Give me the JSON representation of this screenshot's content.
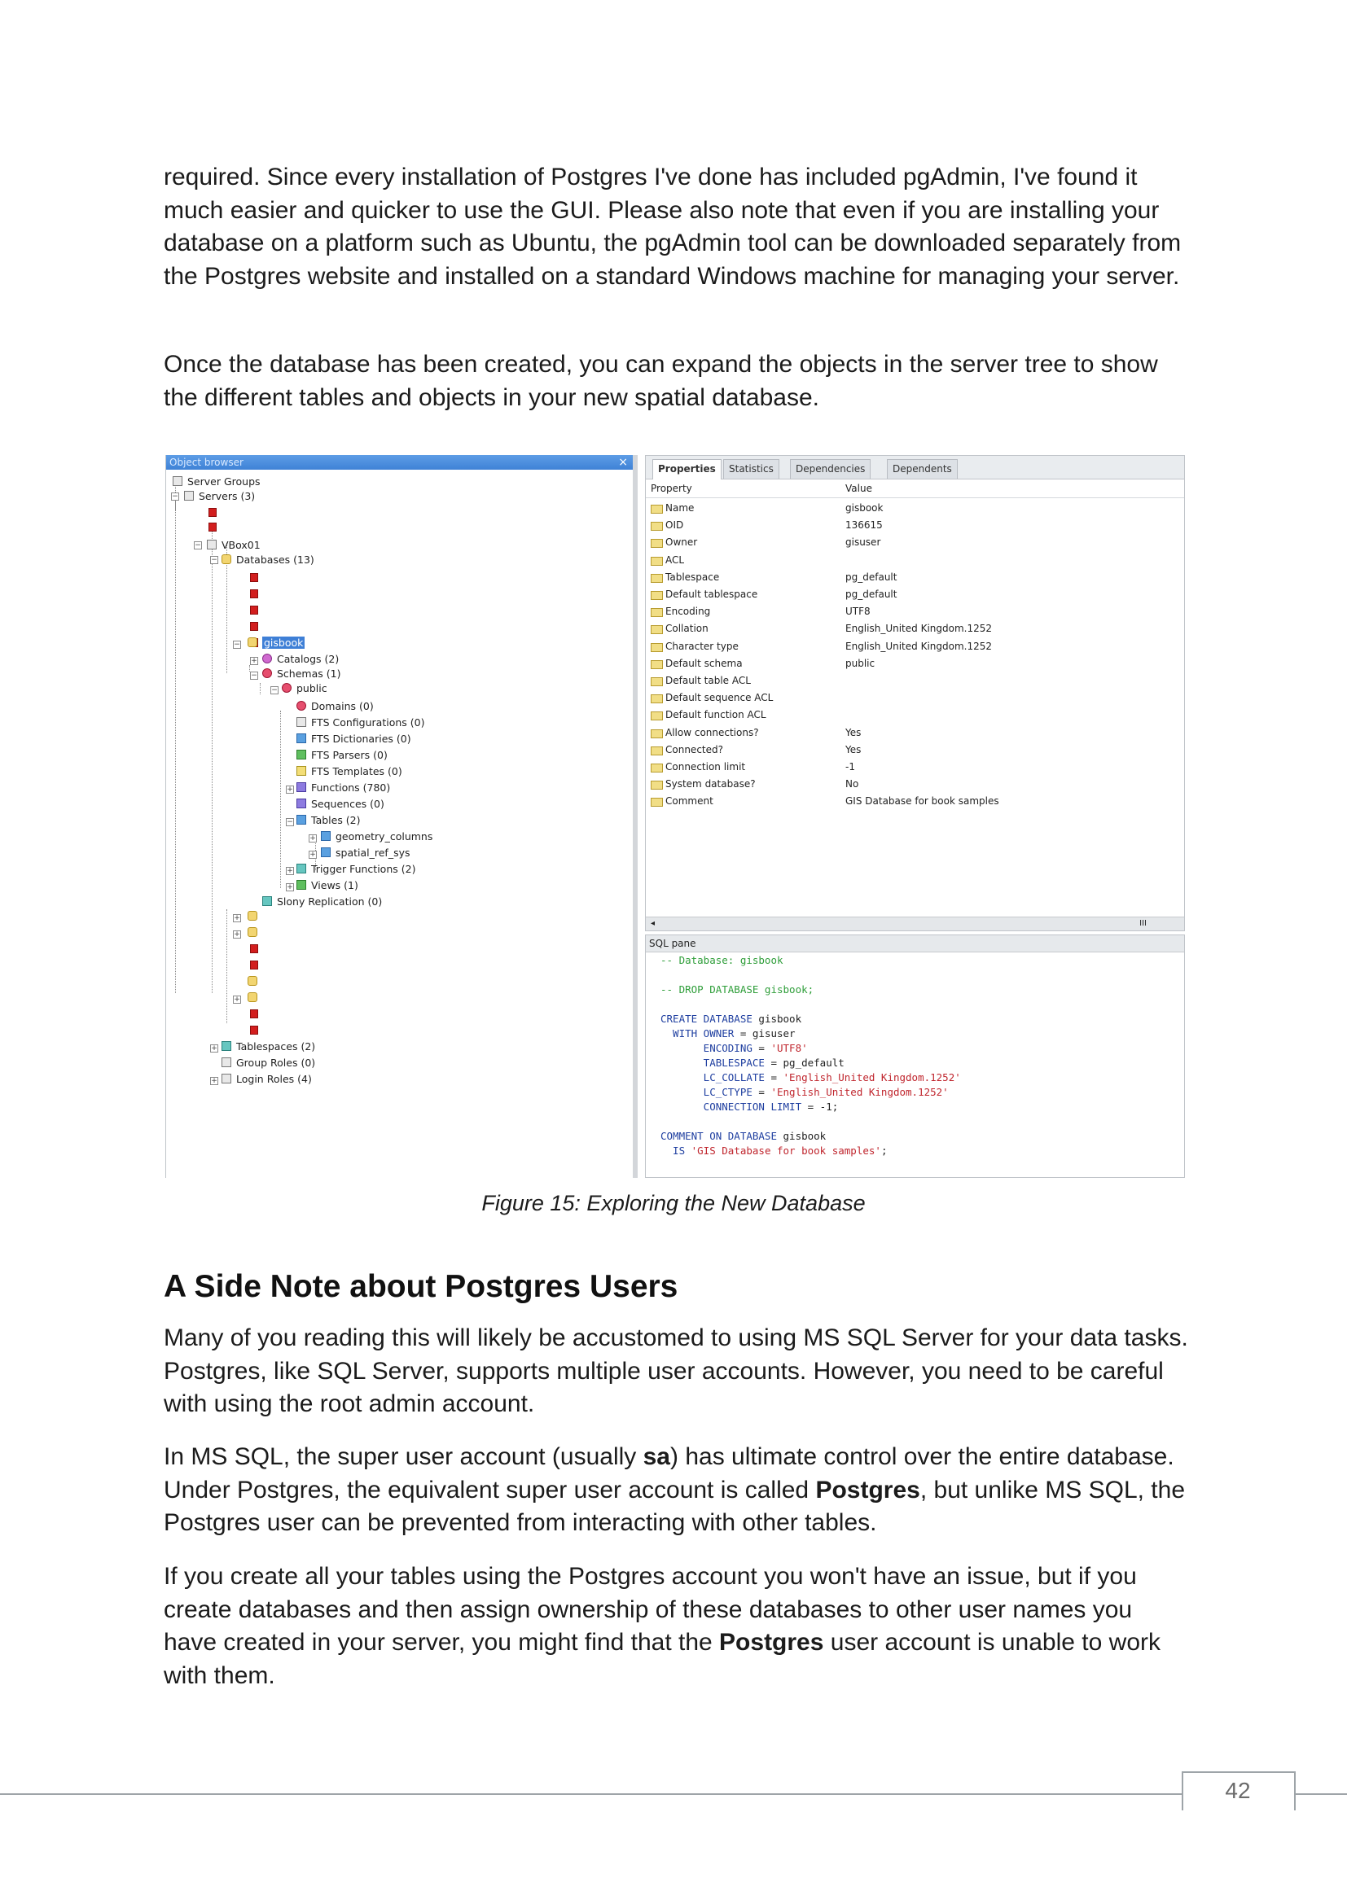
{
  "paragraphs": {
    "p1": "required. Since every installation of Postgres I've done has included pgAdmin, I've found it much easier and quicker to use the GUI. Please also note that even if you are installing your database on a platform such as Ubuntu, the pgAdmin tool can be downloaded separately from the Postgres website and installed on a standard Windows machine for managing your server.",
    "p2": "Once the database has been created, you can expand the objects in the server tree to show the different tables and objects in your new spatial database.",
    "p3": "Many of you reading this will likely be accustomed to using MS SQL Server for your data tasks. Postgres, like SQL Server, supports multiple user accounts. However, you need to be careful with using the root admin account.",
    "p4_a": "In MS SQL, the super user account (usually ",
    "p4_b": "sa",
    "p4_c": ") has ultimate control over the entire database. Under Postgres, the equivalent super user account is called ",
    "p4_d": "Postgres",
    "p4_e": ", but unlike MS SQL, the Postgres user can be prevented from interacting with other tables.",
    "p5_a": "If you create all your tables using the Postgres account you won't have an issue, but if you create databases and then assign ownership of these databases to other user names you have created in your server, you might find that the ",
    "p5_b": "Postgres",
    "p5_c": " user account is unable to work with them."
  },
  "heading": "A Side Note about Postgres Users",
  "caption": "Figure 15: Exploring the New Database",
  "page_number": "42",
  "screenshot": {
    "browser_title": "Object browser",
    "close_glyph": "×",
    "tree": {
      "server_groups": "Server Groups",
      "servers": "Servers (3)",
      "vbox": "VBox01",
      "databases": "Databases (13)",
      "gisbook": "gisbook",
      "catalogs": "Catalogs (2)",
      "schemas": "Schemas (1)",
      "public": "public",
      "domains": "Domains (0)",
      "fts_configurations": "FTS Configurations (0)",
      "fts_dictionaries": "FTS Dictionaries (0)",
      "fts_parsers": "FTS Parsers (0)",
      "fts_templates": "FTS Templates (0)",
      "functions": "Functions (780)",
      "sequences": "Sequences (0)",
      "tables": "Tables (2)",
      "geometry_columns": "geometry_columns",
      "spatial_ref_sys": "spatial_ref_sys",
      "trigger_functions": "Trigger Functions (2)",
      "views": "Views (1)",
      "slony": "Slony Replication (0)",
      "tablespaces": "Tablespaces (2)",
      "group_roles": "Group Roles (0)",
      "login_roles": "Login Roles (4)"
    },
    "tabs": [
      "Properties",
      "Statistics",
      "Dependencies",
      "Dependents"
    ],
    "prop_header": {
      "property": "Property",
      "value": "Value"
    },
    "properties": [
      {
        "name": "Name",
        "value": "gisbook"
      },
      {
        "name": "OID",
        "value": "136615"
      },
      {
        "name": "Owner",
        "value": "gisuser"
      },
      {
        "name": "ACL",
        "value": ""
      },
      {
        "name": "Tablespace",
        "value": "pg_default"
      },
      {
        "name": "Default tablespace",
        "value": "pg_default"
      },
      {
        "name": "Encoding",
        "value": "UTF8"
      },
      {
        "name": "Collation",
        "value": "English_United Kingdom.1252"
      },
      {
        "name": "Character type",
        "value": "English_United Kingdom.1252"
      },
      {
        "name": "Default schema",
        "value": "public"
      },
      {
        "name": "Default table ACL",
        "value": ""
      },
      {
        "name": "Default sequence ACL",
        "value": ""
      },
      {
        "name": "Default function ACL",
        "value": ""
      },
      {
        "name": "Allow connections?",
        "value": "Yes"
      },
      {
        "name": "Connected?",
        "value": "Yes"
      },
      {
        "name": "Connection limit",
        "value": "-1"
      },
      {
        "name": "System database?",
        "value": "No"
      },
      {
        "name": "Comment",
        "value": "GIS Database for book samples"
      }
    ],
    "scroll_left": "◂",
    "scroll_right": "III",
    "sql_title": "SQL pane",
    "sql": {
      "l1": "-- Database: gisbook",
      "l2": "-- DROP DATABASE gisbook;",
      "l3_kw": "CREATE DATABASE",
      "l3_rest": " gisbook",
      "l4_kw": "  WITH OWNER",
      "l4_rest": " = gisuser",
      "l5_kw": "       ENCODING",
      "l5_eq": " = ",
      "l5_str": "'UTF8'",
      "l6_kw": "       TABLESPACE",
      "l6_rest": " = pg_default",
      "l7_kw": "       LC_COLLATE",
      "l7_eq": " = ",
      "l7_str": "'English_United Kingdom.1252'",
      "l8_kw": "       LC_CTYPE",
      "l8_eq": " = ",
      "l8_str": "'English_United Kingdom.1252'",
      "l9_kw": "       CONNECTION LIMIT",
      "l9_rest": " = -1;",
      "l10_kw": "COMMENT ON DATABASE",
      "l10_rest": " gisbook",
      "l11_kw": "  IS",
      "l11_str": " 'GIS Database for book samples'",
      "l11_end": ";"
    }
  }
}
